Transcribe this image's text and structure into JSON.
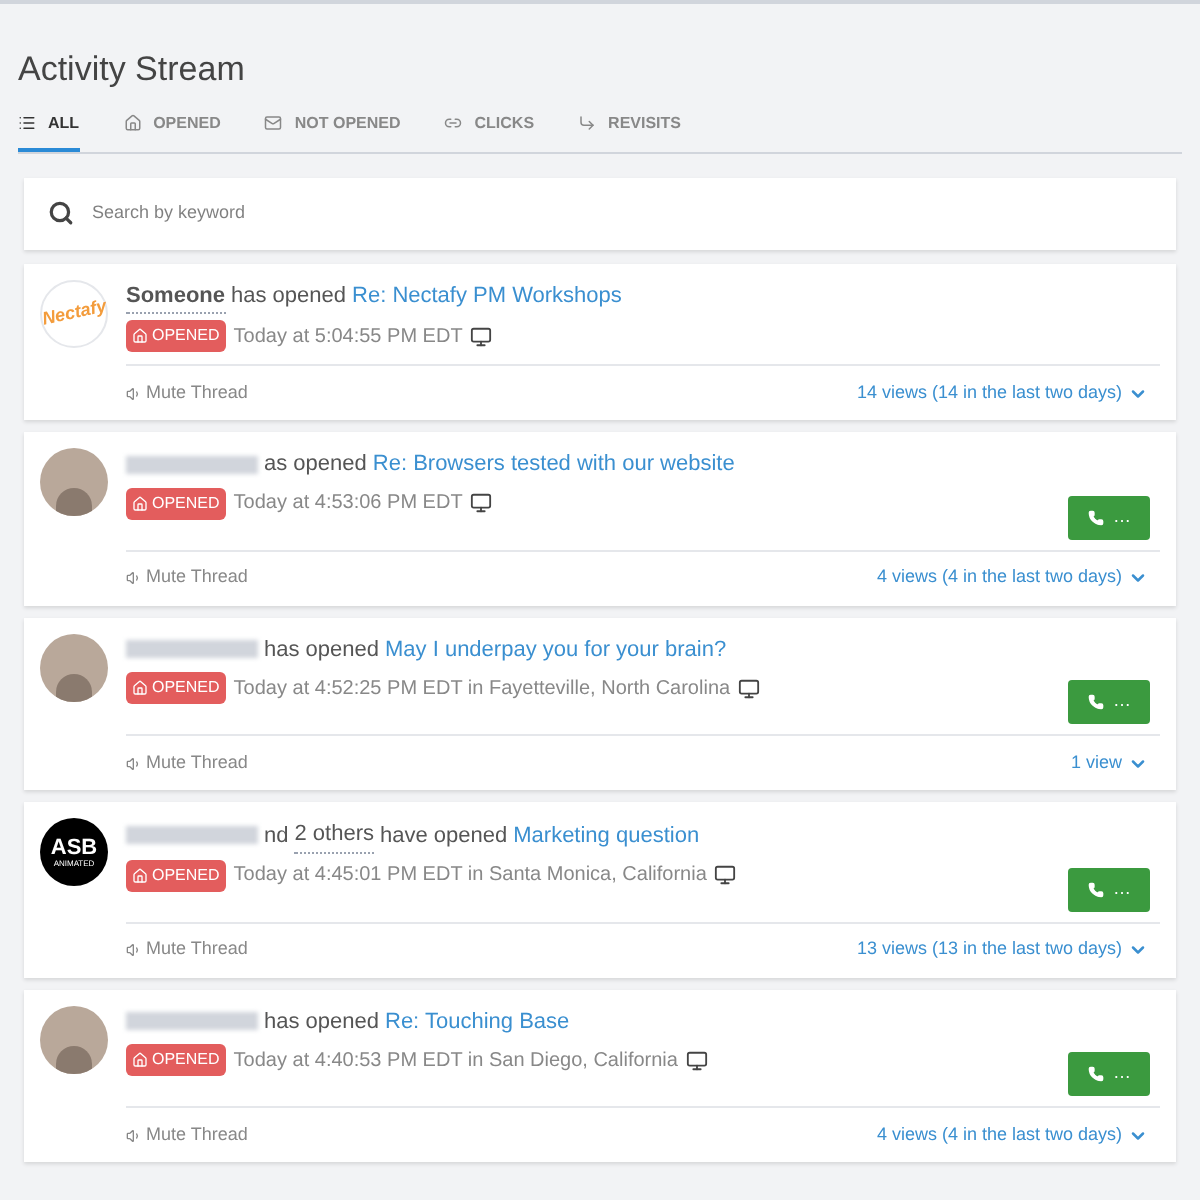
{
  "title": "Activity Stream",
  "tabs": [
    {
      "label": "ALL",
      "selected": true
    },
    {
      "label": "OPENED",
      "selected": false
    },
    {
      "label": "NOT OPENED",
      "selected": false
    },
    {
      "label": "CLICKS",
      "selected": false
    },
    {
      "label": "REVISITS",
      "selected": false
    }
  ],
  "search": {
    "placeholder": "Search by keyword"
  },
  "activities": [
    {
      "avatar": {
        "kind": "logo",
        "text": "Nectafy",
        "color": "#f39c3c"
      },
      "actor": "Someone",
      "verb": "has opened",
      "subject": "Re: Nectafy PM Workshops",
      "badge": "OPENED",
      "time": "Today at 5:04:55 PM EDT",
      "call_button": false,
      "mute": "Mute Thread",
      "views": "14 views (14 in the last two days)"
    },
    {
      "avatar": {
        "kind": "photo"
      },
      "verb": "as opened",
      "subject": "Re: Browsers tested with our website",
      "badge": "OPENED",
      "time": "Today at 4:53:06 PM EDT",
      "call_button": true,
      "call_label": "…",
      "mute": "Mute Thread",
      "views": "4 views (4 in the last two days)"
    },
    {
      "avatar": {
        "kind": "photo"
      },
      "verb": "has opened",
      "subject": "May I underpay you for your brain?",
      "badge": "OPENED",
      "time": "Today at 4:52:25 PM EDT in Fayetteville, North Carolina",
      "call_button": true,
      "call_label": "…",
      "mute": "Mute Thread",
      "views": "1 view"
    },
    {
      "avatar": {
        "kind": "dark-logo",
        "text": "ASB",
        "subtext": "ANIMATED"
      },
      "verb": "nd",
      "others": "2 others",
      "verb_after": "have opened",
      "subject": "Marketing question",
      "badge": "OPENED",
      "time": "Today at 4:45:01 PM EDT in Santa Monica, California",
      "call_button": true,
      "call_label": "…",
      "mute": "Mute Thread",
      "views": "13 views (13 in the last two days)"
    },
    {
      "avatar": {
        "kind": "photo"
      },
      "verb": "has opened",
      "subject": "Re: Touching Base",
      "badge": "OPENED",
      "time": "Today at 4:40:53 PM EDT in San Diego, California",
      "call_button": true,
      "call_label": "…",
      "mute": "Mute Thread",
      "views": "4 views (4 in the last two days)"
    }
  ]
}
